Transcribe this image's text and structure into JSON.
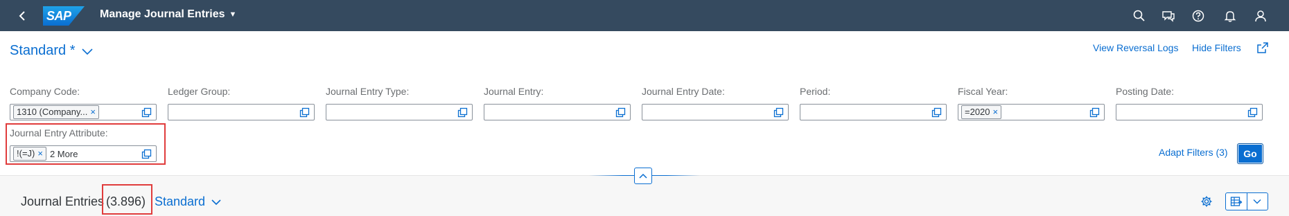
{
  "shell": {
    "app_title": "Manage Journal Entries",
    "logo_text": "SAP",
    "icons": [
      "back-icon",
      "search-icon",
      "feedback-icon",
      "help-icon",
      "notifications-icon",
      "user-icon"
    ]
  },
  "header": {
    "variant": "Standard *",
    "view_reversal_logs": "View Reversal Logs",
    "hide_filters": "Hide Filters",
    "share_icon": "share-icon"
  },
  "filters": [
    {
      "label": "Company Code:",
      "token": "1310 (Company...",
      "more": ""
    },
    {
      "label": "Ledger Group:",
      "token": "",
      "more": ""
    },
    {
      "label": "Journal Entry Type:",
      "token": "",
      "more": ""
    },
    {
      "label": "Journal Entry:",
      "token": "",
      "more": ""
    },
    {
      "label": "Journal Entry Date:",
      "token": "",
      "more": ""
    },
    {
      "label": "Period:",
      "token": "",
      "more": ""
    },
    {
      "label": "Fiscal Year:",
      "token": "=2020",
      "more": ""
    },
    {
      "label": "Posting Date:",
      "token": "",
      "more": ""
    },
    {
      "label": "Journal Entry Attribute:",
      "token": "!(=J)",
      "more": "2 More"
    }
  ],
  "filterbar": {
    "adapt_filters": "Adapt Filters (3)",
    "go": "Go",
    "token_remove": "×"
  },
  "table": {
    "title": "Journal Entries",
    "count": "(3.896)",
    "variant": "Standard"
  },
  "colors": {
    "shell": "#354a5f",
    "accent": "#0a6ed1",
    "highlight": "#e03c3c"
  }
}
